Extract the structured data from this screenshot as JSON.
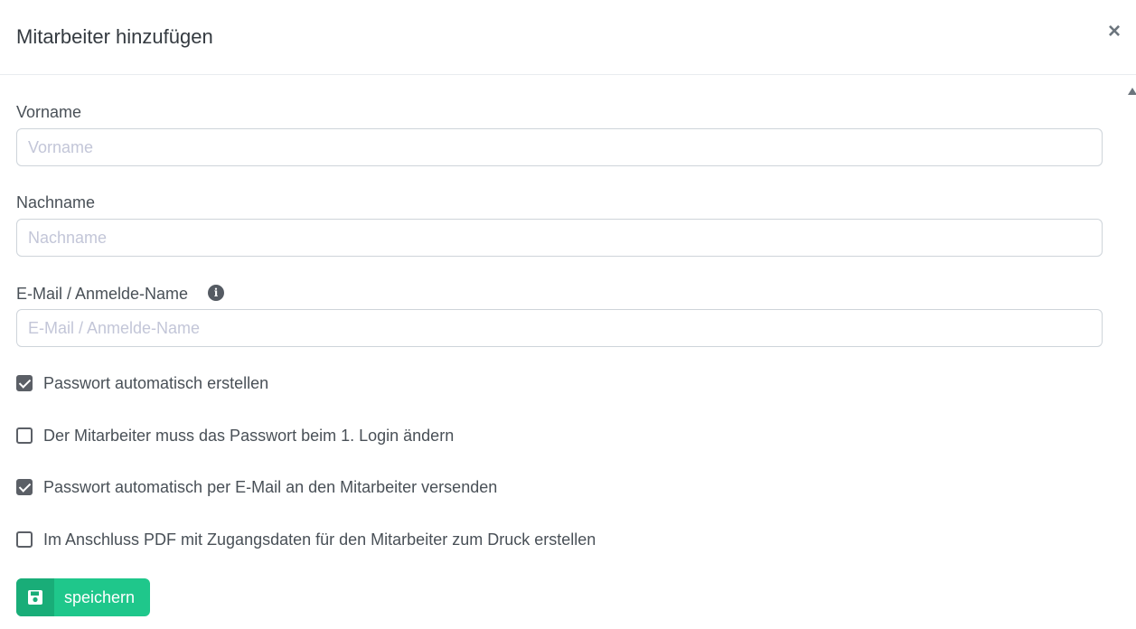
{
  "modal": {
    "title": "Mitarbeiter hinzufügen",
    "close_label": "×"
  },
  "form": {
    "vorname": {
      "label": "Vorname",
      "placeholder": "Vorname",
      "value": ""
    },
    "nachname": {
      "label": "Nachname",
      "placeholder": "Nachname",
      "value": ""
    },
    "email": {
      "label": "E-Mail / Anmelde-Name",
      "placeholder": "E-Mail / Anmelde-Name",
      "value": "",
      "info_icon": "info-circle-icon"
    },
    "checkboxes": [
      {
        "label": "Passwort automatisch erstellen",
        "checked": true
      },
      {
        "label": "Der Mitarbeiter muss das Passwort beim 1. Login ändern",
        "checked": false
      },
      {
        "label": "Passwort automatisch per E-Mail an den Mitarbeiter versenden",
        "checked": true
      },
      {
        "label": "Im Anschluss PDF mit Zugangsdaten für den Mitarbeiter zum Druck erstellen",
        "checked": false
      }
    ],
    "save_button": {
      "label": "speichern",
      "icon": "floppy-disk-icon"
    }
  },
  "colors": {
    "accent": "#1fc78b",
    "accent_dark": "#19ad78",
    "checkbox": "#5b5f66",
    "placeholder": "#c3c6d8"
  }
}
